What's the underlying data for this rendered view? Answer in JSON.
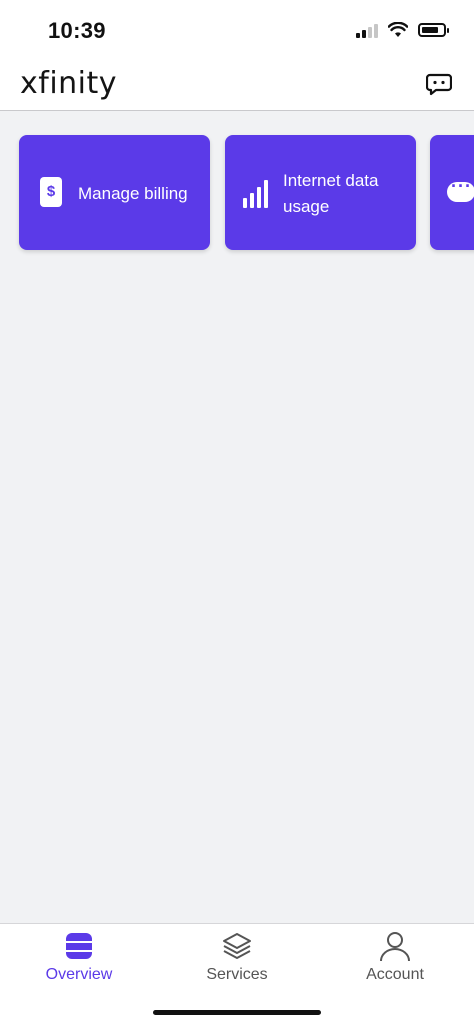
{
  "status_bar": {
    "time": "10:39"
  },
  "header": {
    "logo": "xfinity",
    "chat_icon": "chat-bubble-icon"
  },
  "quick_actions": [
    {
      "label": "Manage billing",
      "icon": "dollar-icon"
    },
    {
      "label": "Internet data usage",
      "icon": "bar-chart-icon"
    },
    {
      "label": "",
      "icon": "chat-icon"
    }
  ],
  "bottom_nav": {
    "items": [
      {
        "label": "Overview",
        "icon": "overview-icon",
        "active": true
      },
      {
        "label": "Services",
        "icon": "layers-icon",
        "active": false
      },
      {
        "label": "Account",
        "icon": "person-icon",
        "active": false
      }
    ]
  },
  "colors": {
    "accent": "#5b3ae8",
    "background": "#f1f2f4"
  }
}
